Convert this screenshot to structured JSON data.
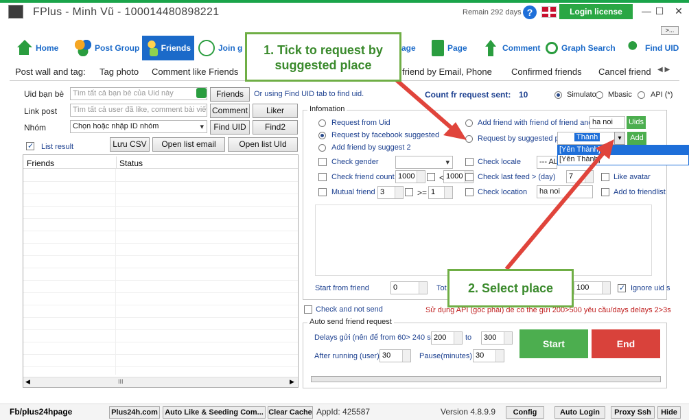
{
  "window": {
    "title": "FPlus - Minh Vũ - 100014480898221",
    "remain": "Remain 292 days",
    "help": "?",
    "login_label": "Login license",
    "more_label": ">..."
  },
  "nav": {
    "items": [
      {
        "label": "Home",
        "icon": "home-icon"
      },
      {
        "label": "Post Group",
        "icon": "group-icon"
      },
      {
        "label": "Friends",
        "icon": "friends-icon"
      },
      {
        "label": "Join g",
        "icon": "join-icon"
      },
      {
        "label": "age"
      },
      {
        "label": "Page",
        "icon": "page-icon"
      },
      {
        "label": "Comment",
        "icon": "comment-icon"
      },
      {
        "label": "Graph Search",
        "icon": "search-icon"
      },
      {
        "label": "Find UID",
        "icon": "find-uid-icon"
      }
    ]
  },
  "subtabs": [
    "Post wall and tag:",
    "Tag photo",
    "Comment like Friends",
    "friend by Email, Phone",
    "Confirmed friends",
    "Cancel friend"
  ],
  "left": {
    "uid_label": "Uid bạn bè",
    "uid_placeholder": "Tìm tất cả bạn bè của Uid này",
    "friends_btn": "Friends",
    "hint": "Or using Find UID tab to find uid.",
    "link_label": "Link post",
    "link_placeholder": "Tìm tất cả user đã like, comment bài viết",
    "comment_btn": "Comment",
    "liker_btn": "Liker",
    "group_label": "Nhóm",
    "group_value": "Chọn hoặc nhập ID nhóm",
    "find_uid_btn": "Find UID",
    "find2_btn": "Find2",
    "list_result": "List result",
    "save_csv": "Lưu CSV",
    "open_email": "Open list email",
    "open_uid": "Open list UId",
    "col_friends": "Friends",
    "col_status": "Status",
    "scroll_mid": "III"
  },
  "right": {
    "count_label": "Count fr request sent:",
    "count_value": "10",
    "mode_simulator": "Simulator",
    "mode_mbasic": "Mbasic",
    "mode_api": "API (*)",
    "info_title": "Infomation",
    "req_uid": "Request from Uid",
    "req_fb": "Request by facebook suggested",
    "add_suggest": "Add friend by suggest 2",
    "add_fof": "Add friend with friend of friend and",
    "fof_value": "ha noi",
    "uids_btn": "Uids",
    "req_place": "Request by suggested place",
    "place_value": "Thành",
    "add_btn": "Add",
    "dropdown_items": [
      "[Yên Thành]",
      "[Yên Thành]"
    ],
    "check_gender": "Check gender",
    "check_locale": "Check locale",
    "locale_value": "--- ALI",
    "check_friend_count": "Check friend count",
    "fc_min": "1000",
    "fc_lt": "<",
    "fc_max": "1000",
    "check_last_feed": "Check last feed > (day)",
    "feed_days": "7",
    "like_avatar": "Like avatar",
    "mutual": "Mutual friend <",
    "mutual_val": "3",
    "mutual_ge": ">=",
    "mutual_ge_val": "1",
    "check_location": "Check location",
    "location_value": "ha noi",
    "add_to_list": "Add to friendlist a",
    "start_from": "Start from friend",
    "start_val": "0",
    "tot": "Tot",
    "tot_val": "100",
    "ignore_uid": "Ignore uid s",
    "check_not_send": "Check and not send",
    "warning": "Sử dụng API (gốc phải) để có thể gửi 200>500 yêu cầu/days delays 2>3s",
    "auto_title": "Auto send friend request",
    "delays_label": "Delays gửi (nên để from 60> 240 s)",
    "delay_from": "200",
    "to_label": "to",
    "delay_to": "300",
    "after_label": "After running (user)",
    "after_val": "30",
    "pause_label": "Pause(minutes)",
    "pause_val": "30",
    "start_btn": "Start",
    "end_btn": "End"
  },
  "callouts": {
    "one": "1. Tick to request by suggested place",
    "two": "2. Select place"
  },
  "status": {
    "fb": "Fb/plus24hpage",
    "plus24h": "Plus24h.com",
    "auto_like": "Auto Like & Seeding Com...",
    "clear_cache": "Clear Cache",
    "appid": "AppId: 425587",
    "version": "Version 4.8.9.9",
    "config": "Config",
    "auto_login": "Auto Login",
    "proxy": "Proxy Ssh",
    "hide": "Hide"
  },
  "colors": {
    "accent": "#1b6ac9",
    "brand_green": "#2aa744",
    "annotation_red": "#e0443b"
  }
}
